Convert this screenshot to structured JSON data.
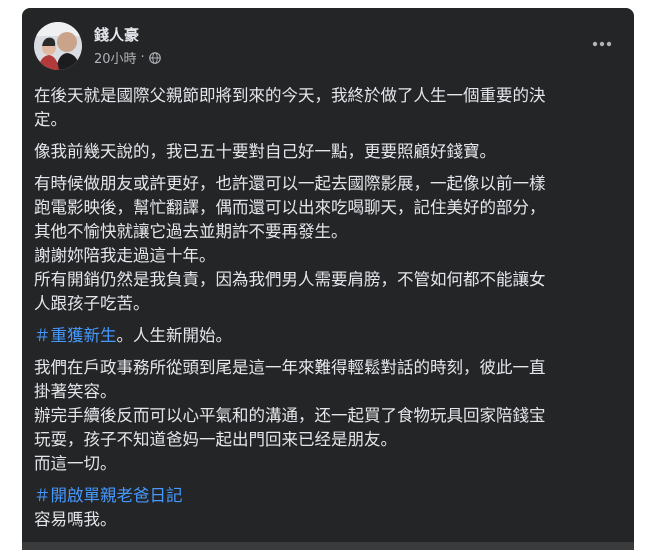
{
  "post": {
    "author": "錢人豪",
    "timestamp": "20小時",
    "separator": "·",
    "privacy_icon": "globe-icon",
    "more_icon": "more-horizontal-icon"
  },
  "body": {
    "p1": {
      "line1": "在後天就是國際父親節即將到來的今天，我終於做了人生一個重要的決",
      "line2": "定。"
    },
    "p2": {
      "line1": "像我前幾天說的，我已五十要對自己好一點，更要照顧好錢寶。"
    },
    "p3": {
      "line1": "有時候做朋友或許更好，也許還可以一起去國際影展，一起像以前一樣",
      "line2": "跑電影映後，幫忙翻譯，偶而還可以出來吃喝聊天，記住美好的部分，",
      "line3": "其他不愉快就讓它過去並期許不要再發生。",
      "line4": "謝謝妳陪我走過這十年。",
      "line5": "所有開銷仍然是我負責，因為我們男人需要肩膀，不管如何都不能讓女",
      "line6": "人跟孩子吃苦。"
    },
    "p4": {
      "hashtag": "＃重獲新生",
      "rest": "。人生新開始。"
    },
    "p5": {
      "line1": "我們在戶政事務所從頭到尾是這一年來難得輕鬆對話的時刻，彼此一直",
      "line2": "掛著笑容。",
      "line3": "辦完手續後反而可以心平氣和的溝通，还一起買了食物玩具回家陪錢宝",
      "line4": "玩耍，孩子不知道爸妈一起出門回来已经是朋友。",
      "line5": "而這一切。"
    },
    "p6": {
      "hashtag": "＃開啟單親老爸日記",
      "line2": "容易嗎我。"
    }
  },
  "colors": {
    "card_bg": "#242526",
    "text": "#e4e6eb",
    "secondary_text": "#b0b3b8",
    "hashtag": "#4599ff"
  }
}
